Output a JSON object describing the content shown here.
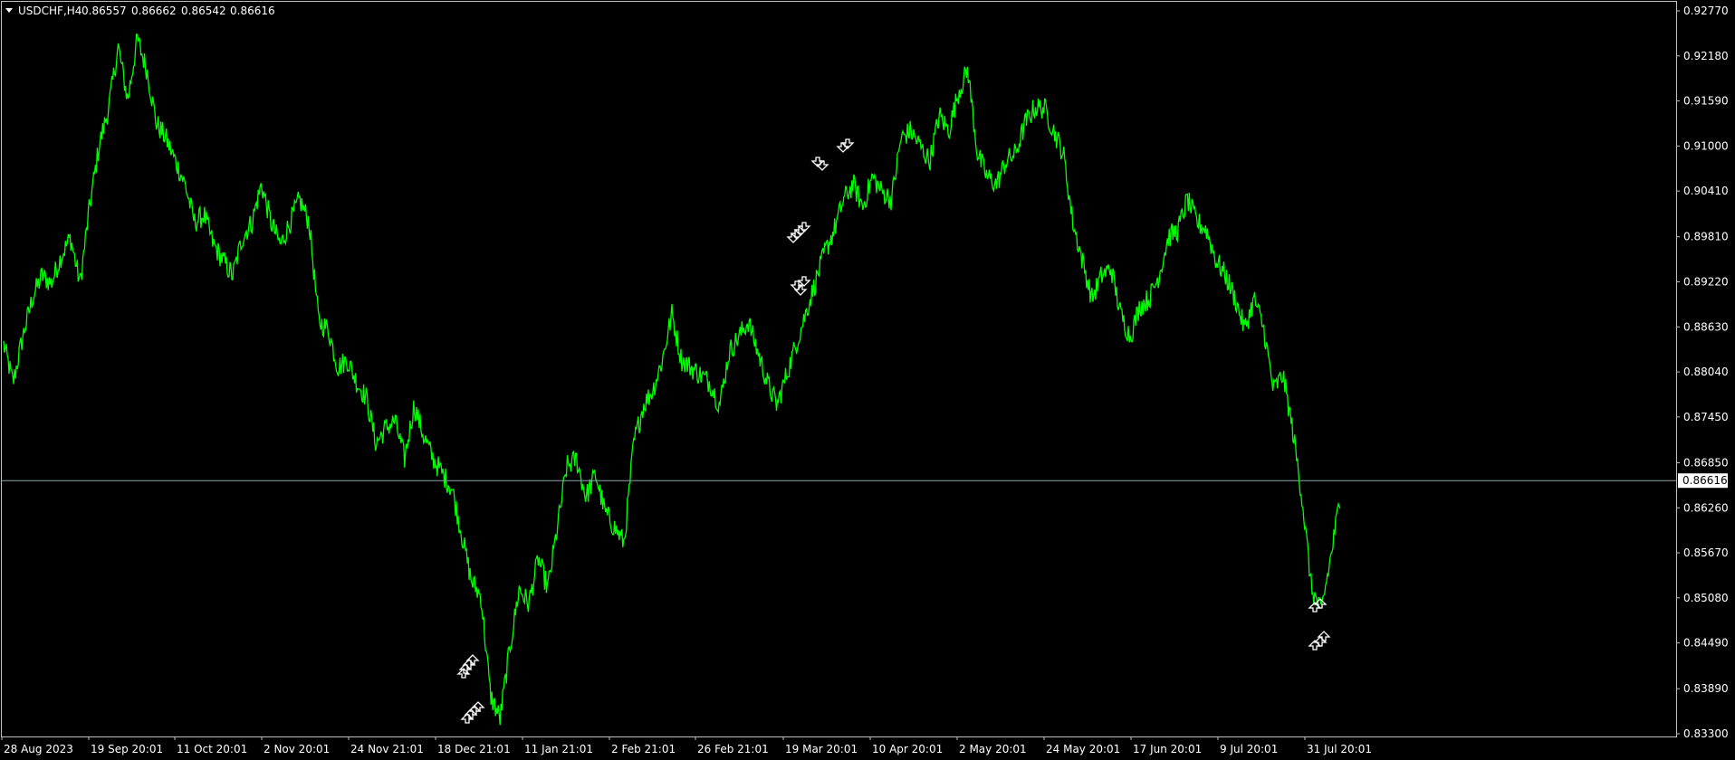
{
  "header": {
    "symbol_timeframe": "USDCHF,H4",
    "open": "0.86557",
    "high": "0.86662",
    "low": "0.86542",
    "close": "0.86616"
  },
  "colors": {
    "background": "#000000",
    "price_line": "#00ff00",
    "text": "#ffffff",
    "grid_frame": "#c0c0c0",
    "bid_line": "#8fa3b0",
    "marker": "#ffffff"
  },
  "current_price_label": "0.86616",
  "chart_data": {
    "type": "line",
    "title": "",
    "xlabel": "",
    "ylabel": "",
    "y_ticks": [
      "0.92770",
      "0.92180",
      "0.91590",
      "0.91000",
      "0.90410",
      "0.89810",
      "0.89220",
      "0.88630",
      "0.88040",
      "0.87450",
      "0.86850",
      "0.86260",
      "0.85670",
      "0.85080",
      "0.84490",
      "0.83890",
      "0.83300"
    ],
    "ylim": [
      0.833,
      0.9277
    ],
    "x_ticks": [
      "28 Aug 2023",
      "19 Sep 20:01",
      "11 Oct 20:01",
      "2 Nov 20:01",
      "24 Nov 21:01",
      "18 Dec 21:01",
      "11 Jan 21:01",
      "2 Feb 21:01",
      "26 Feb 21:01",
      "19 Mar 20:01",
      "10 Apr 20:01",
      "2 May 20:01",
      "24 May 20:01",
      "17 Jun 20:01",
      "9 Jul 20:01",
      "31 Jul 20:01"
    ],
    "current_price": 0.86616,
    "series": [
      {
        "values": [
          0.884,
          0.879,
          0.885,
          0.89,
          0.893,
          0.892,
          0.8955,
          0.898,
          0.892,
          0.902,
          0.91,
          0.915,
          0.923,
          0.916,
          0.924,
          0.92,
          0.913,
          0.911,
          0.908,
          0.905,
          0.9,
          0.901,
          0.897,
          0.895,
          0.893,
          0.898,
          0.9,
          0.905,
          0.9,
          0.897,
          0.9,
          0.903,
          0.9,
          0.887,
          0.886,
          0.881,
          0.882,
          0.879,
          0.877,
          0.871,
          0.873,
          0.874,
          0.869,
          0.876,
          0.872,
          0.869,
          0.867,
          0.865,
          0.859,
          0.853,
          0.851,
          0.838,
          0.835,
          0.844,
          0.852,
          0.85,
          0.856,
          0.852,
          0.86,
          0.868,
          0.869,
          0.864,
          0.867,
          0.862,
          0.86,
          0.858,
          0.871,
          0.876,
          0.878,
          0.882,
          0.888,
          0.882,
          0.881,
          0.88,
          0.879,
          0.876,
          0.883,
          0.885,
          0.887,
          0.883,
          0.879,
          0.876,
          0.88,
          0.884,
          0.888,
          0.892,
          0.896,
          0.899,
          0.903,
          0.905,
          0.902,
          0.906,
          0.904,
          0.903,
          0.911,
          0.912,
          0.91,
          0.908,
          0.914,
          0.912,
          0.917,
          0.92,
          0.909,
          0.906,
          0.905,
          0.908,
          0.909,
          0.913,
          0.915,
          0.915,
          0.912,
          0.909,
          0.9,
          0.895,
          0.89,
          0.893,
          0.894,
          0.888,
          0.885,
          0.889,
          0.89,
          0.893,
          0.898,
          0.899,
          0.903,
          0.9,
          0.899,
          0.895,
          0.893,
          0.89,
          0.886,
          0.89,
          0.886,
          0.878,
          0.88,
          0.873,
          0.864,
          0.852,
          0.849,
          0.856,
          0.864
        ],
        "color": "#00ff00"
      }
    ],
    "markers": {
      "buy_arrows_dec": 8,
      "sell_arrows_mar": 5,
      "buy_arrows_aug": 4
    }
  }
}
